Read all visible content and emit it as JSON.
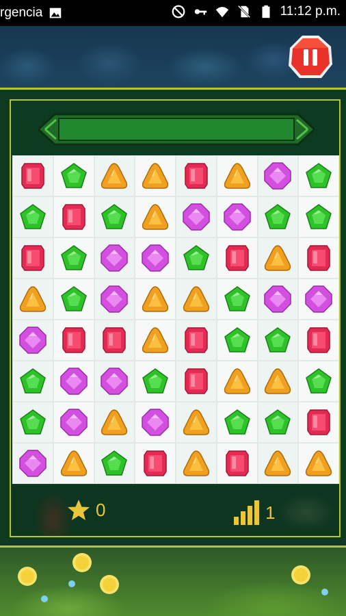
{
  "status_bar": {
    "carrier_text": "rgencia",
    "time": "11:12 p.m.",
    "icons": [
      "image-icon",
      "do-not-disturb-icon",
      "key-icon",
      "wifi-icon",
      "no-sim-icon",
      "battery-icon"
    ]
  },
  "game": {
    "pause_icon": "pause-icon",
    "star_score": "0",
    "level": "1",
    "colors": {
      "red": "#e32a52",
      "green": "#2fc12a",
      "orange": "#f0a020",
      "purple": "#d24fe0",
      "frame_gold": "#b9c62a",
      "score_gold": "#e8c83a"
    },
    "grid": [
      [
        "red",
        "green",
        "orange",
        "orange",
        "red",
        "orange",
        "purple",
        "green"
      ],
      [
        "green",
        "red",
        "green",
        "orange",
        "purple",
        "purple",
        "green",
        "green"
      ],
      [
        "red",
        "green",
        "purple",
        "purple",
        "green",
        "red",
        "orange",
        "red"
      ],
      [
        "orange",
        "green",
        "purple",
        "orange",
        "orange",
        "green",
        "purple",
        "purple"
      ],
      [
        "purple",
        "red",
        "red",
        "orange",
        "red",
        "green",
        "green",
        "red"
      ],
      [
        "green",
        "purple",
        "purple",
        "green",
        "red",
        "orange",
        "orange",
        "green"
      ],
      [
        "green",
        "purple",
        "orange",
        "purple",
        "orange",
        "green",
        "green",
        "red"
      ],
      [
        "purple",
        "orange",
        "green",
        "red",
        "orange",
        "red",
        "orange",
        "orange"
      ]
    ]
  }
}
